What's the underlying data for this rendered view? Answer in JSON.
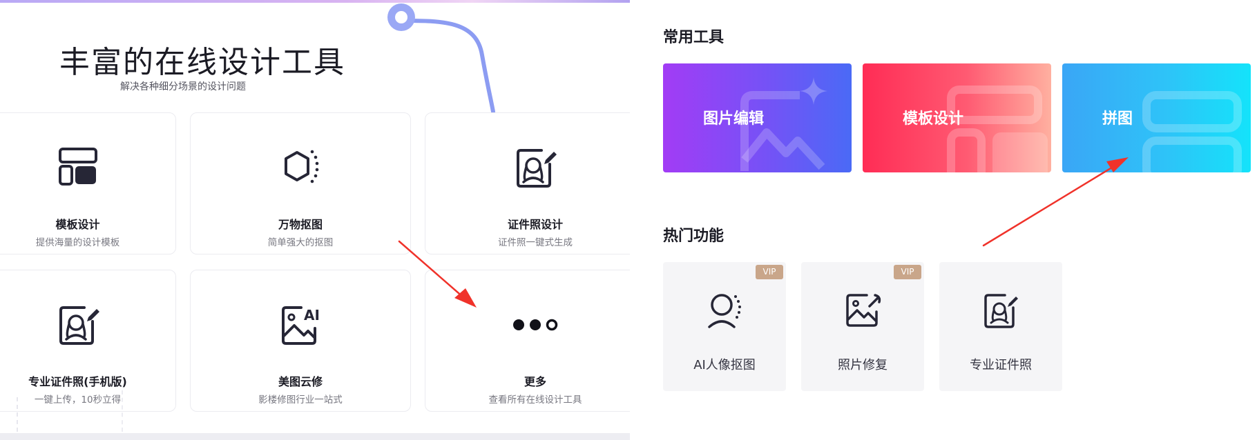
{
  "hero": {
    "title": "丰富的在线设计工具",
    "subtitle": "解决各种细分场景的设计问题"
  },
  "tool_cards": [
    {
      "title": "模板设计",
      "desc": "提供海量的设计模板",
      "icon": "layout-icon"
    },
    {
      "title": "万物抠图",
      "desc": "简单强大的抠图",
      "icon": "hexagon-cutout-icon"
    },
    {
      "title": "证件照设计",
      "desc": "证件照一键式生成",
      "icon": "id-photo-icon"
    },
    {
      "title": "专业证件照(手机版)",
      "desc": "一键上传，10秒立得",
      "icon": "id-photo-icon"
    },
    {
      "title": "美图云修",
      "desc": "影楼修图行业一站式",
      "icon": "ai-image-icon"
    },
    {
      "title": "更多",
      "desc": "查看所有在线设计工具",
      "icon": "more-dots-icon"
    }
  ],
  "common_tools": {
    "title": "常用工具",
    "items": [
      {
        "label": "图片编辑",
        "icon": "image-edit-icon"
      },
      {
        "label": "模板设计",
        "icon": "template-icon"
      },
      {
        "label": "拼图",
        "icon": "collage-icon"
      }
    ]
  },
  "hot_features": {
    "title": "热门功能",
    "items": [
      {
        "label": "AI人像抠图",
        "badge": "VIP",
        "icon": "portrait-cutout-icon"
      },
      {
        "label": "照片修复",
        "badge": "VIP",
        "icon": "photo-repair-icon"
      },
      {
        "label": "专业证件照",
        "badge": "",
        "icon": "id-photo-icon"
      }
    ]
  },
  "colors": {
    "arrow": "#f0322a",
    "vip_badge": "#c9a68a",
    "deco_line": "#8c9cf2"
  }
}
